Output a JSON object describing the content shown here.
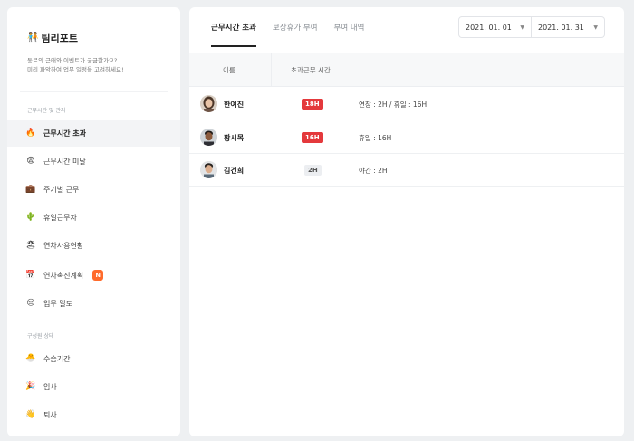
{
  "brand": {
    "title": "팀리포트",
    "subtitle_line1": "동료의 근태와 이벤트가 궁금한가요?",
    "subtitle_line2": "미리 파악하여 업무 일정을 고려하세요!"
  },
  "sidebar": {
    "section1": "근무시간 및 관리",
    "section2": "구성원 상태",
    "items": [
      {
        "label": "근무시간 초과",
        "icon": "fire-icon"
      },
      {
        "label": "근무시간 미달",
        "icon": "anxious-face-icon"
      },
      {
        "label": "주기별 근무",
        "icon": "briefcase-icon"
      },
      {
        "label": "휴일근무자",
        "icon": "cactus-icon"
      },
      {
        "label": "연차사용현황",
        "icon": "beach-icon"
      },
      {
        "label": "연차촉진계획",
        "icon": "calendar-icon",
        "badge": "N"
      },
      {
        "label": "업무 밀도",
        "icon": "neutral-face-icon"
      },
      {
        "label": "수습기간",
        "icon": "chick-icon"
      },
      {
        "label": "입사",
        "icon": "party-popper-icon"
      },
      {
        "label": "퇴사",
        "icon": "waving-hand-icon"
      }
    ]
  },
  "tabs": [
    {
      "label": "근무시간 초과"
    },
    {
      "label": "보상휴가 부여"
    },
    {
      "label": "부여 내역"
    }
  ],
  "date_range": {
    "start": "2021. 01. 01",
    "end": "2021. 01. 31"
  },
  "table": {
    "headers": [
      "이름",
      "초과근무 시간"
    ],
    "rows": [
      {
        "name": "한여진",
        "hours": "18H",
        "detail": "연장 : 2H / 휴일 : 16H",
        "status": "red"
      },
      {
        "name": "황시목",
        "hours": "16H",
        "detail": "휴일 : 16H",
        "status": "red"
      },
      {
        "name": "김건희",
        "hours": "2H",
        "detail": "야간 : 2H",
        "status": "grey"
      }
    ]
  },
  "colors": {
    "accent_red": "#e4393c",
    "badge_orange": "#ff6b2c"
  }
}
